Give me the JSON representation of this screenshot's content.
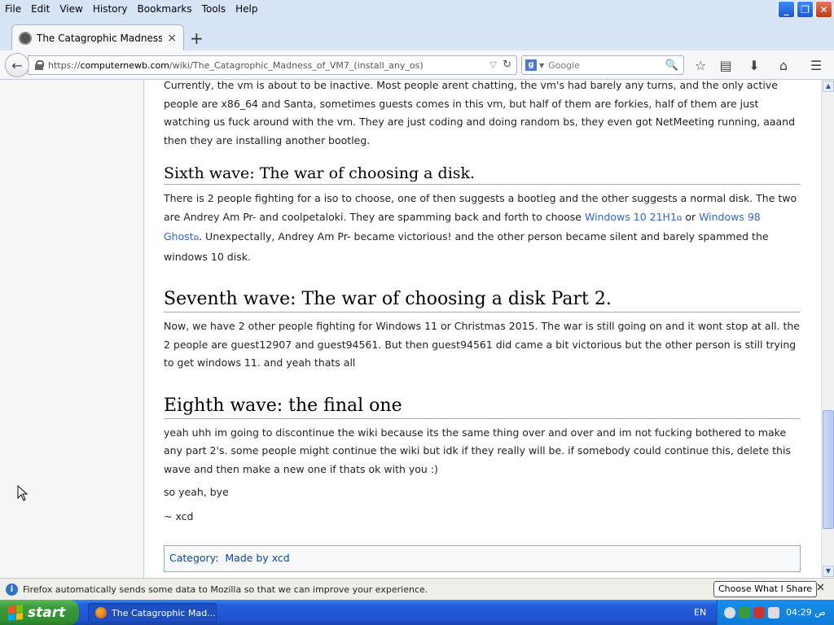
{
  "menubar": {
    "items": [
      "File",
      "Edit",
      "View",
      "History",
      "Bookmarks",
      "Tools",
      "Help"
    ]
  },
  "tab": {
    "title": "The Catagrophic Madness of ...",
    "close": "×"
  },
  "newtab": "+",
  "url": {
    "scheme": "https://",
    "host": "computernewb.com",
    "path": "/wiki/The_Catagrophic_Madness_of_VM7_(install_any_os)"
  },
  "search": {
    "engine": "Google"
  },
  "article": {
    "intro": "Currently, the vm is about to be inactive. Most people arent chatting, the vm's had barely any turns, and the only active people are x86_64 and Santa, sometimes guests comes in this vm, but half of them are forkies, half of them are just watching us fuck around with the vm. They are just coding and doing random bs, they even got NetMeeting running, aaand then they are installing another bootleg.",
    "sixth": {
      "heading": "Sixth wave: The war of choosing a disk.",
      "text_a": "There is 2 people fighting for a iso to choose, one of then suggests a bootleg and the other suggests a normal disk. The two are Andrey Am Pr- and coolpetaloki. They are spamming back and forth to choose ",
      "link1": "Windows 10 21H1",
      "text_b": " or ",
      "link2": "Windows 98 Ghost",
      "text_c": ". Unexpectally, Andrey Am Pr- became victorious! and the other person became silent and barely spammed the windows 10 disk."
    },
    "seventh": {
      "heading": "Seventh wave: The war of choosing a disk Part 2.",
      "text": "Now, we have 2 other people fighting for Windows 11 or Christmas 2015. The war is still going on and it wont stop at all. the 2 people are guest12907 and guest94561. But then guest94561 did came a bit victorious but the other person is still trying to get windows 11. and yeah thats all"
    },
    "eighth": {
      "heading": "Eighth wave: the final one",
      "text": "yeah uhh im going to discontinue the wiki because its the same thing over and over and im not fucking bothered to make any part 2's. some people might continue the wiki but idk if they really will be. if somebody could continue this, delete this wave and then make a new one if thats ok with you :)",
      "bye": "so yeah, bye",
      "sig": "~ xcd"
    },
    "category_label": "Category",
    "category_value": "Made by xcd"
  },
  "notification": {
    "text": "Firefox automatically sends some data to Mozilla so that we can improve your experience.",
    "button": "Choose What I Share",
    "close": "✕"
  },
  "taskbar": {
    "start": "start",
    "task": "The Catagrophic Mad...",
    "lang": "EN",
    "clock": "04:29 ص"
  }
}
